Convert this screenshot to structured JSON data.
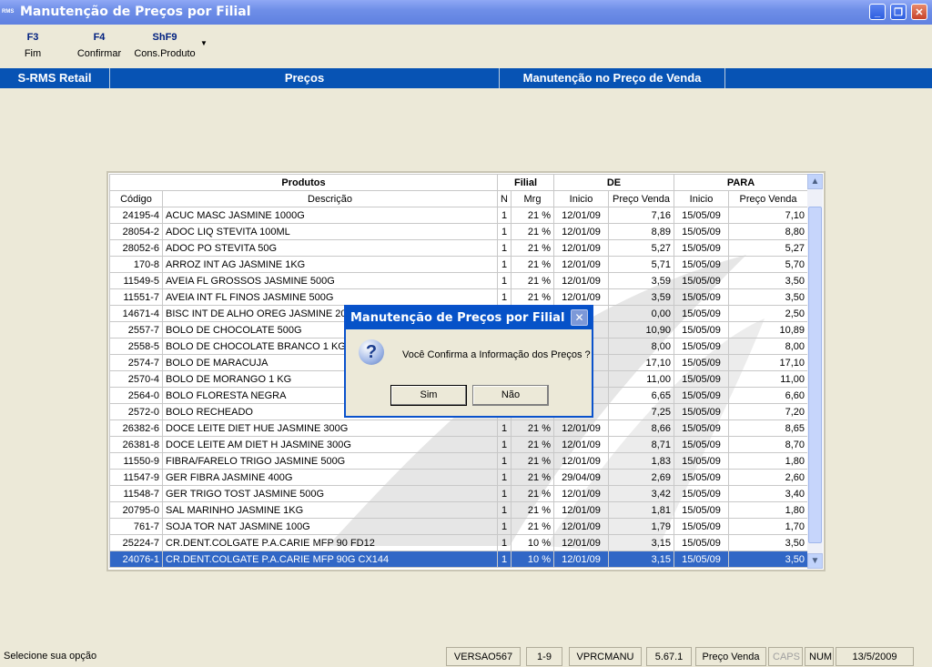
{
  "window": {
    "app_icon": "RMS",
    "title": "Manutenção de Preços por Filial",
    "minimize_icon": "minimize-icon",
    "restore_icon": "restore-icon",
    "close_icon": "close-icon"
  },
  "toolbar": [
    {
      "key": "F3",
      "label": "Fim"
    },
    {
      "key": "F4",
      "label": "Confirmar"
    },
    {
      "key": "ShF9",
      "label": "Cons.Produto"
    }
  ],
  "header_bar": {
    "app": "S-RMS Retail",
    "section": "Preços",
    "screen": "Manutenção no Preço de Venda"
  },
  "grid": {
    "group_headers": {
      "produtos": "Produtos",
      "filial": "Filial",
      "de": "DE",
      "para": "PARA"
    },
    "columns": {
      "codigo": "Código",
      "descricao": "Descrição",
      "n": "N",
      "mrg": "Mrg",
      "de_inicio": "Inicio",
      "de_preco": "Preço Venda",
      "para_inicio": "Inicio",
      "para_preco": "Preço Venda"
    },
    "rows": [
      [
        "24195-4",
        "ACUC MASC JASMINE 1000G",
        "1",
        "21 %",
        "12/01/09",
        "7,16",
        "15/05/09",
        "7,10"
      ],
      [
        "28054-2",
        "ADOC LIQ STEVITA 100ML",
        "1",
        "21 %",
        "12/01/09",
        "8,89",
        "15/05/09",
        "8,80"
      ],
      [
        "28052-6",
        "ADOC PO STEVITA 50G",
        "1",
        "21 %",
        "12/01/09",
        "5,27",
        "15/05/09",
        "5,27"
      ],
      [
        "170-8",
        "ARROZ INT AG JASMINE 1KG",
        "1",
        "21 %",
        "12/01/09",
        "5,71",
        "15/05/09",
        "5,70"
      ],
      [
        "11549-5",
        "AVEIA FL GROSSOS JASMINE 500G",
        "1",
        "21 %",
        "12/01/09",
        "3,59",
        "15/05/09",
        "3,50"
      ],
      [
        "11551-7",
        "AVEIA INT FL FINOS JASMINE 500G",
        "1",
        "21 %",
        "12/01/09",
        "3,59",
        "15/05/09",
        "3,50"
      ],
      [
        "14671-4",
        "BISC INT DE ALHO OREG JASMINE 200G",
        "",
        "",
        "",
        "0,00",
        "15/05/09",
        "2,50"
      ],
      [
        "2557-7",
        "BOLO DE CHOCOLATE 500G",
        "",
        "",
        "9",
        "10,90",
        "15/05/09",
        "10,89"
      ],
      [
        "2558-5",
        "BOLO DE CHOCOLATE BRANCO 1 KG",
        "",
        "",
        "9",
        "8,00",
        "15/05/09",
        "8,00"
      ],
      [
        "2574-7",
        "BOLO DE MARACUJA",
        "",
        "",
        "9",
        "17,10",
        "15/05/09",
        "17,10"
      ],
      [
        "2570-4",
        "BOLO DE MORANGO 1 KG",
        "",
        "",
        "9",
        "11,00",
        "15/05/09",
        "11,00"
      ],
      [
        "2564-0",
        "BOLO FLORESTA NEGRA",
        "",
        "",
        "9",
        "6,65",
        "15/05/09",
        "6,60"
      ],
      [
        "2572-0",
        "BOLO RECHEADO",
        "",
        "",
        "9",
        "7,25",
        "15/05/09",
        "7,20"
      ],
      [
        "26382-6",
        "DOCE  LEITE DIET HUE JASMINE 300G",
        "1",
        "21 %",
        "12/01/09",
        "8,66",
        "15/05/09",
        "8,65"
      ],
      [
        "26381-8",
        "DOCE LEITE AM DIET H JASMINE 300G",
        "1",
        "21 %",
        "12/01/09",
        "8,71",
        "15/05/09",
        "8,70"
      ],
      [
        "11550-9",
        "FIBRA/FARELO TRIGO JASMINE 500G",
        "1",
        "21 %",
        "12/01/09",
        "1,83",
        "15/05/09",
        "1,80"
      ],
      [
        "11547-9",
        "GER FIBRA JASMINE 400G",
        "1",
        "21 %",
        "29/04/09",
        "2,69",
        "15/05/09",
        "2,60"
      ],
      [
        "11548-7",
        "GER TRIGO TOST JASMINE 500G",
        "1",
        "21 %",
        "12/01/09",
        "3,42",
        "15/05/09",
        "3,40"
      ],
      [
        "20795-0",
        "SAL MARINHO JASMINE 1KG",
        "1",
        "21 %",
        "12/01/09",
        "1,81",
        "15/05/09",
        "1,80"
      ],
      [
        "761-7",
        "SOJA TOR NAT JASMINE 100G",
        "1",
        "21 %",
        "12/01/09",
        "1,79",
        "15/05/09",
        "1,70"
      ],
      [
        "25224-7",
        "CR.DENT.COLGATE P.A.CARIE MFP 90 FD12",
        "1",
        "10 %",
        "12/01/09",
        "3,15",
        "15/05/09",
        "3,50"
      ],
      [
        "24076-1",
        "CR.DENT.COLGATE P.A.CARIE MFP 90G CX144",
        "1",
        "10 %",
        "12/01/09",
        "3,15",
        "15/05/09",
        "3,50"
      ]
    ]
  },
  "dialog": {
    "title": "Manutenção de Preços por Filial",
    "icon": "question-icon",
    "message": "Você Confirma a Informação dos Preços ?",
    "yes": "Sim",
    "no": "Não"
  },
  "status": {
    "message": "Selecione sua opção",
    "version": "VERSAO567",
    "page": "1-9",
    "program": "VPRCMANU",
    "build": "5.67.1",
    "field": "Preço Venda",
    "caps": "CAPS",
    "num": "NUM",
    "date": "13/5/2009"
  },
  "colors": {
    "accent": "#0753b4",
    "selection": "#3167c6",
    "titlebar": "#6f8fe8"
  }
}
